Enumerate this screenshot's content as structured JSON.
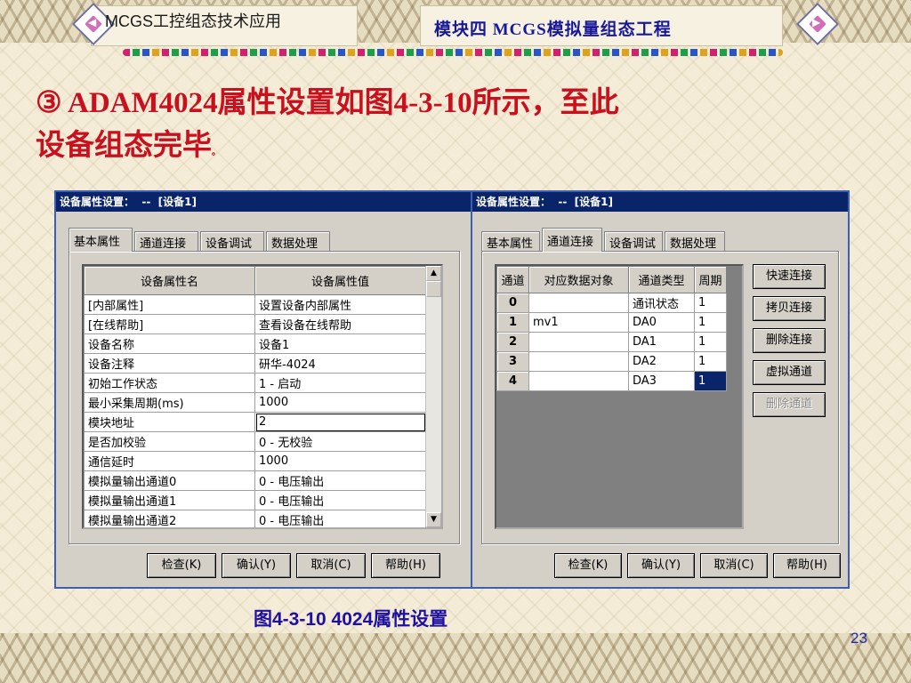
{
  "slide": {
    "course_title": "MCGS工控组态技术应用",
    "module_title": "模块四  MCGS模拟量组态工程",
    "heading_line1": "③   ADAM4024属性设置如图4-3-10所示，至此",
    "heading_line2": "设备组态完毕",
    "heading_note": "。",
    "caption": "图4-3-10  4024属性设置",
    "page_number": "23",
    "nav_left_icon": "nav-left-diamond",
    "nav_right_icon": "nav-right-diamond"
  },
  "dialog_left": {
    "title": "设备属性设置：  --  [设备1]",
    "tabs": [
      "基本属性",
      "通道连接",
      "设备调试",
      "数据处理"
    ],
    "active_tab": "基本属性",
    "columns": [
      "设备属性名",
      "设备属性值"
    ],
    "rows": [
      [
        "[内部属性]",
        "设置设备内部属性"
      ],
      [
        "[在线帮助]",
        "查看设备在线帮助"
      ],
      [
        "设备名称",
        "设备1"
      ],
      [
        "设备注释",
        "研华-4024"
      ],
      [
        "初始工作状态",
        "1 - 启动"
      ],
      [
        "最小采集周期(ms)",
        "1000"
      ],
      [
        "模块地址",
        "2"
      ],
      [
        "是否加校验",
        "0 - 无校验"
      ],
      [
        "通信延时",
        "1000"
      ],
      [
        "模拟量输出通道0",
        "0 - 电压输出"
      ],
      [
        "模拟量输出通道1",
        "0 - 电压输出"
      ],
      [
        "模拟量输出通道2",
        "0 - 电压输出"
      ]
    ],
    "editing_row": 6,
    "buttons": {
      "check": "检查(K)",
      "confirm": "确认(Y)",
      "cancel": "取消(C)",
      "help": "帮助(H)"
    }
  },
  "dialog_right": {
    "title": "设备属性设置：  --  [设备1]",
    "tabs": [
      "基本属性",
      "通道连接",
      "设备调试",
      "数据处理"
    ],
    "active_tab": "通道连接",
    "columns": [
      "通道",
      "对应数据对象",
      "通道类型",
      "周期"
    ],
    "rows": [
      [
        "0",
        "",
        "通讯状态",
        "1"
      ],
      [
        "1",
        "mv1",
        "DA0",
        "1"
      ],
      [
        "2",
        "",
        "DA1",
        "1"
      ],
      [
        "3",
        "",
        "DA2",
        "1"
      ],
      [
        "4",
        "",
        "DA3",
        "1"
      ]
    ],
    "side_buttons": {
      "quick_connect": "快速连接",
      "copy_connect": "拷贝连接",
      "delete_connect": "删除连接",
      "virtual_channel": "虚拟通道",
      "delete_channel": "删除通道"
    },
    "buttons": {
      "check": "检查(K)",
      "confirm": "确认(Y)",
      "cancel": "取消(C)",
      "help": "帮助(H)"
    }
  }
}
